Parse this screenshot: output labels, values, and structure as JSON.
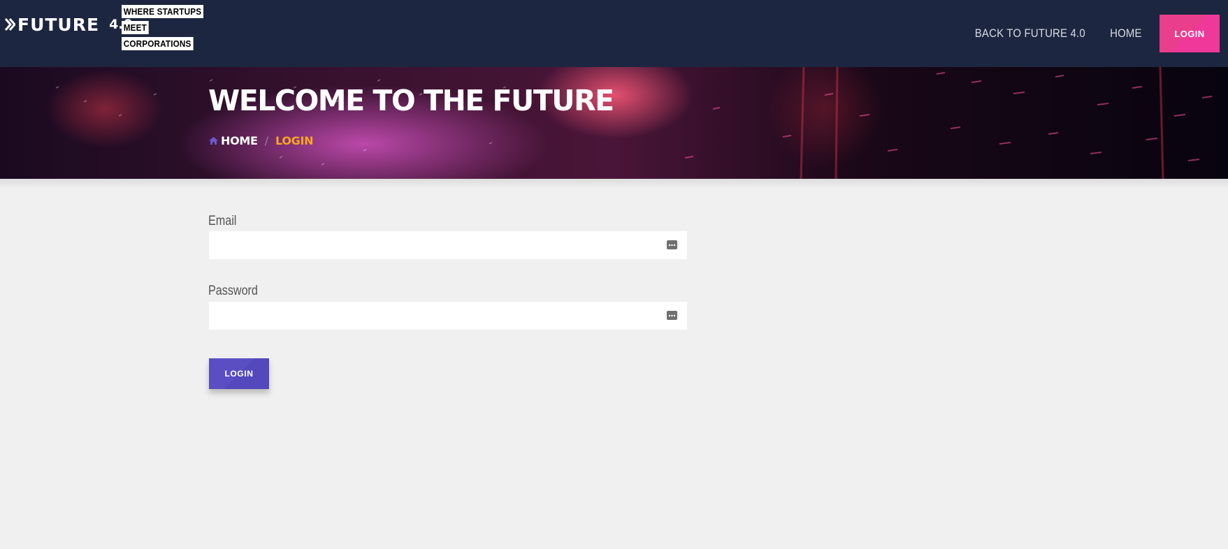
{
  "header": {
    "logo_text": "FUTURE",
    "logo_version": "4.0",
    "tagline": [
      "WHERE STARTUPS",
      "MEET",
      "CORPORATIONS"
    ],
    "nav": {
      "back_link": "BACK TO FUTURE 4.0",
      "home_link": "HOME",
      "login_button": "LOGIN"
    }
  },
  "hero": {
    "title": "WELCOME TO THE FUTURE",
    "breadcrumb": {
      "home": "HOME",
      "separator": "/",
      "current": "LOGIN"
    }
  },
  "form": {
    "email_label": "Email",
    "email_value": "",
    "password_label": "Password",
    "password_value": "",
    "submit_label": "LOGIN"
  },
  "icons": {
    "logo": "double-chevron-logo-icon",
    "breadcrumb_home": "home-icon",
    "field_autofill": "password-manager-key-icon"
  },
  "colors": {
    "header_bg": "#1d2640",
    "nav_login_bg": "#e83e8c",
    "submit_bg": "#5b4ec2",
    "breadcrumb_current": "#f6a623",
    "page_bg": "#f0f0f0"
  }
}
